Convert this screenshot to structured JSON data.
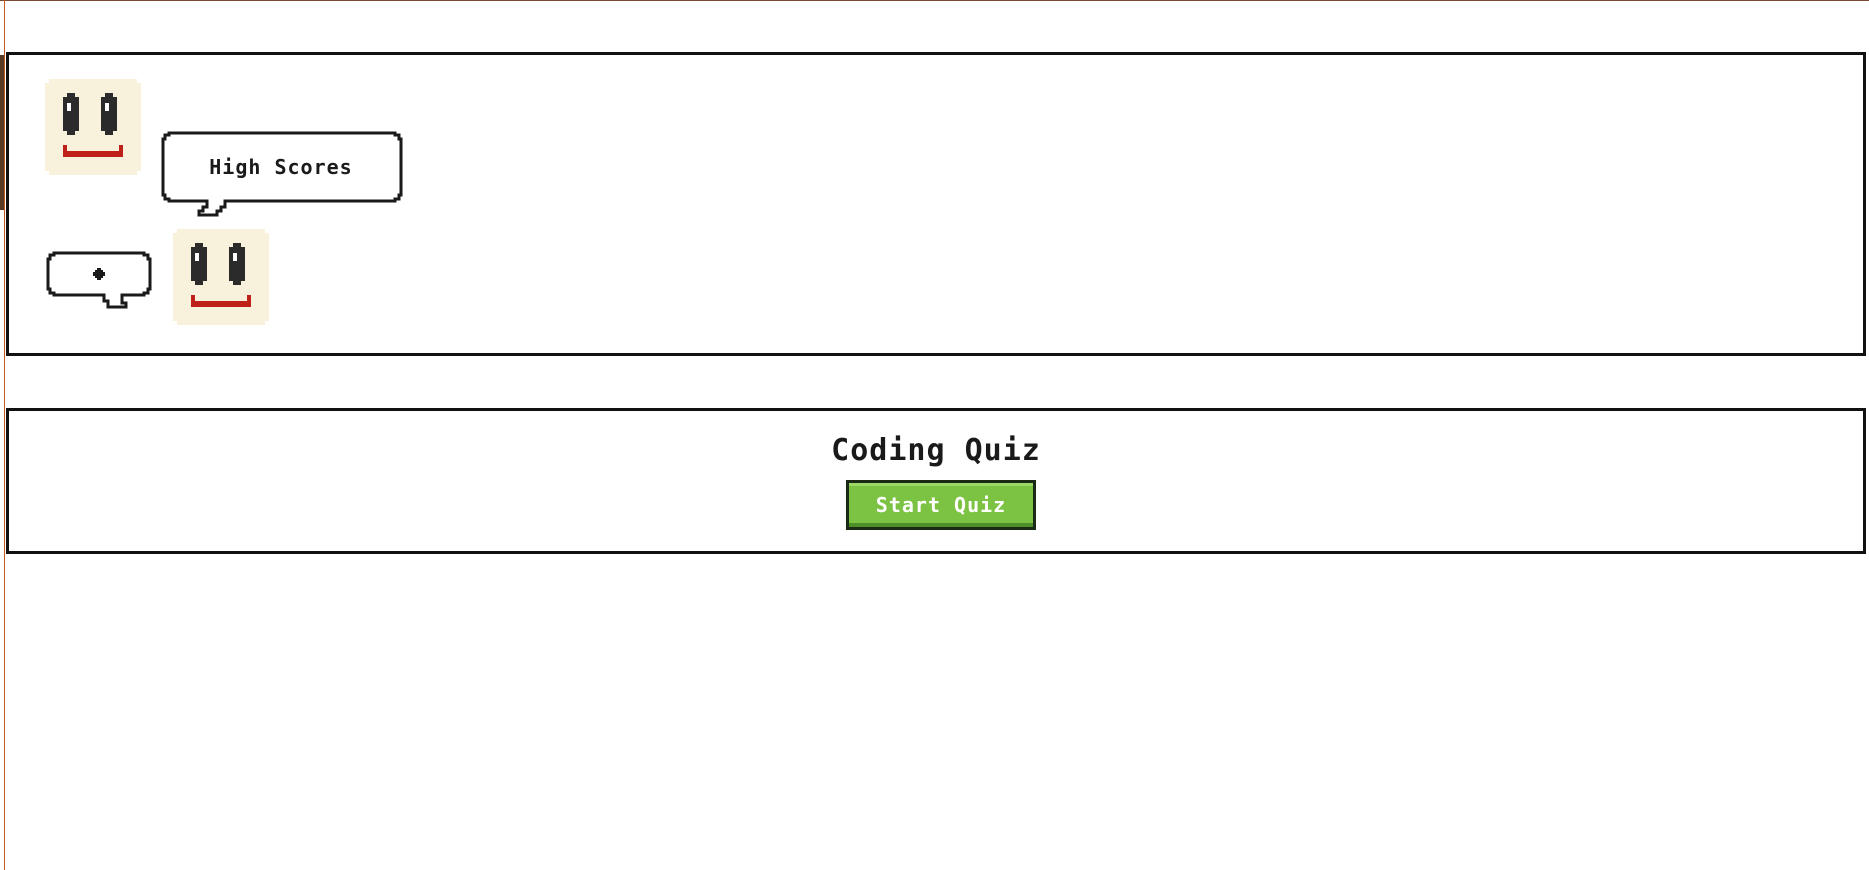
{
  "header": {
    "bubble_label": "High Scores"
  },
  "main": {
    "title": "Coding Quiz",
    "start_label": "Start Quiz"
  },
  "colors": {
    "avatar_bg": "#f8f1dc",
    "eye": "#2b2b2b",
    "mouth": "#c0201a",
    "button": "#7cc343",
    "border": "#111111"
  },
  "icons": [
    "smiley-face-icon",
    "speech-bubble-icon"
  ]
}
